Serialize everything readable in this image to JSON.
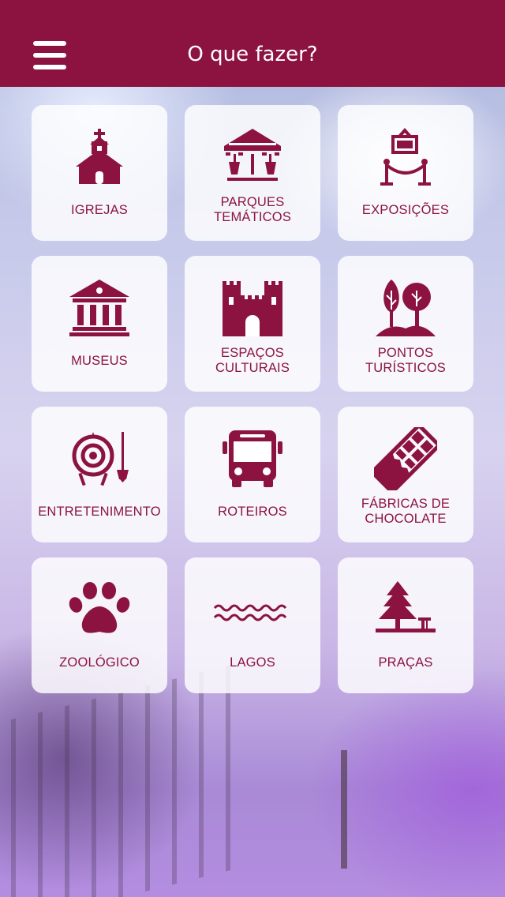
{
  "header": {
    "title": "O que fazer?",
    "menu_icon": "hamburger-menu-icon",
    "color": "#8c1340"
  },
  "accent_color": "#8c1340",
  "tiles": [
    {
      "label": "IGREJAS",
      "icon": "church-icon"
    },
    {
      "label": "PARQUES\nTEMÁTICOS",
      "icon": "carousel-icon"
    },
    {
      "label": "EXPOSIÇÕES",
      "icon": "exhibition-icon"
    },
    {
      "label": "MUSEUS",
      "icon": "museum-icon"
    },
    {
      "label": "ESPAÇOS\nCULTURAIS",
      "icon": "castle-icon"
    },
    {
      "label": "PONTOS\nTURÍSTICOS",
      "icon": "trees-icon"
    },
    {
      "label": "ENTRETENIMENTO",
      "icon": "target-dart-icon"
    },
    {
      "label": "ROTEIROS",
      "icon": "bus-icon"
    },
    {
      "label": "FÁBRICAS DE\nCHOCOLATE",
      "icon": "chocolate-bar-icon"
    },
    {
      "label": "ZOOLÓGICO",
      "icon": "paw-icon"
    },
    {
      "label": "LAGOS",
      "icon": "waves-icon"
    },
    {
      "label": "PRAÇAS",
      "icon": "park-tree-bench-icon"
    }
  ]
}
